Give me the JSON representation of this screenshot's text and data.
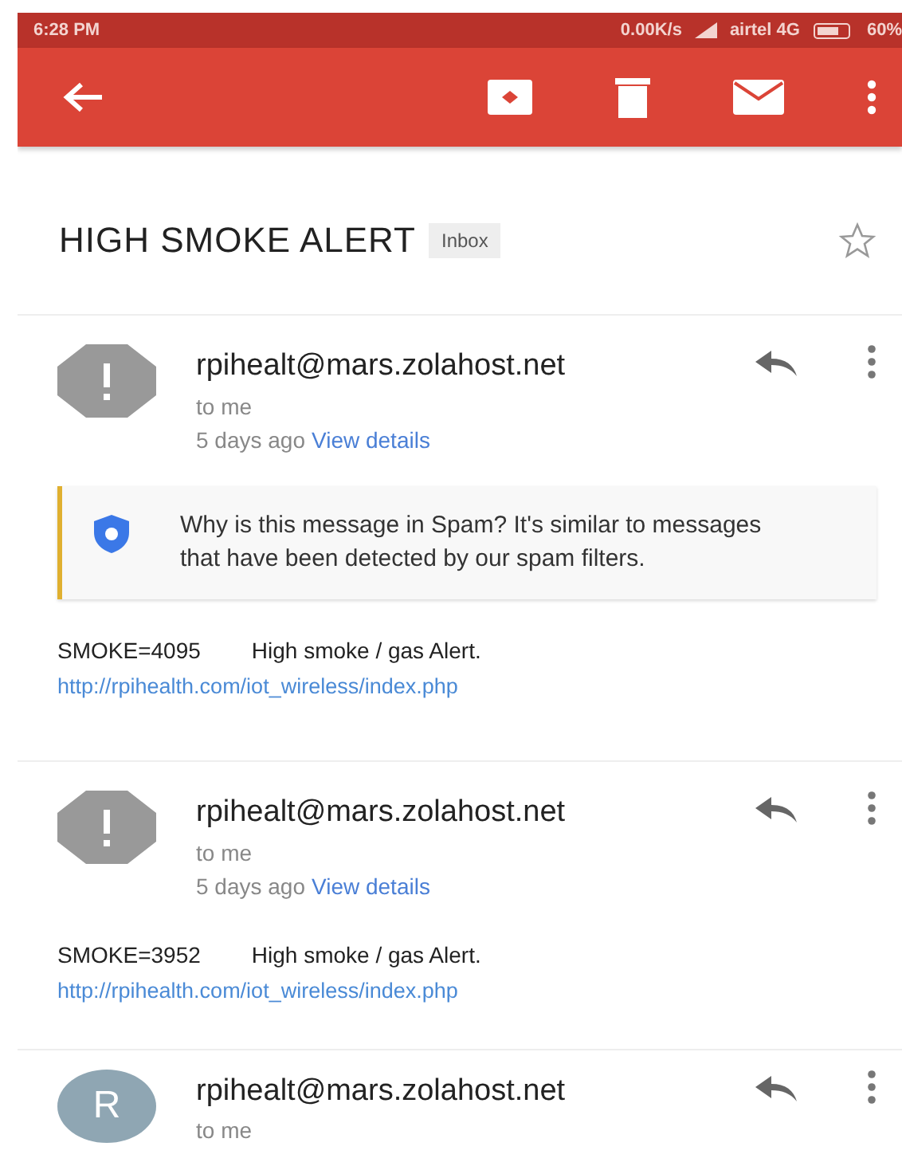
{
  "status_bar": {
    "time": "6:28 PM",
    "speed": "0.00K/s",
    "carrier": "airtel 4G",
    "battery": "60%"
  },
  "subject": {
    "title": "HIGH SMOKE ALERT",
    "label": "Inbox",
    "starred": false
  },
  "messages": [
    {
      "avatar": {
        "kind": "spam"
      },
      "sender": "rpihealt@mars.zolahost.net",
      "recipient": "to me",
      "time": "5 days ago",
      "details_link": "View details",
      "spam_notice": "Why is this message in Spam? It's similar to messages that have been detected by our spam filters.",
      "body": {
        "reading": "SMOKE=4095",
        "text": "High smoke / gas Alert.",
        "link": "http://rpihealth.com/iot_wireless/index.php"
      }
    },
    {
      "avatar": {
        "kind": "spam"
      },
      "sender": "rpihealt@mars.zolahost.net",
      "recipient": "to me",
      "time": "5 days ago",
      "details_link": "View details",
      "body": {
        "reading": "SMOKE=3952",
        "text": "High smoke / gas Alert.",
        "link": "http://rpihealth.com/iot_wireless/index.php"
      }
    },
    {
      "avatar": {
        "kind": "letter",
        "letter": "R"
      },
      "sender": "rpihealt@mars.zolahost.net",
      "recipient": "to me"
    }
  ]
}
